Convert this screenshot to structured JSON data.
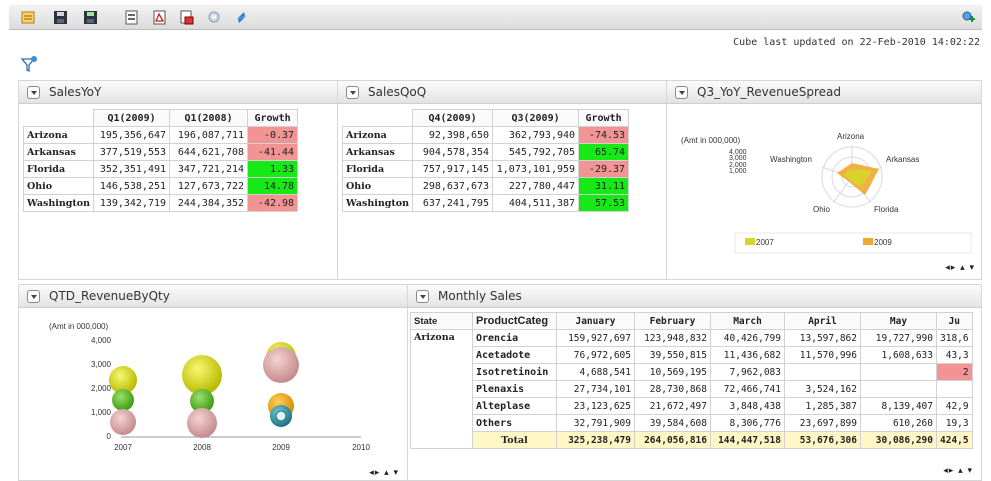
{
  "toolbar": {
    "icons": [
      "edit-icon",
      "save-icon",
      "save-as-icon",
      "export-icon",
      "export-pdf-icon",
      "print-icon",
      "settings-icon",
      "refresh-icon"
    ],
    "right_icon": "add-connection-icon"
  },
  "cube_note": "Cube last updated on 22-Feb-2010 14:02:22",
  "sales_yoy": {
    "title": "SalesYoY",
    "headers": [
      "Q1(2009)",
      "Q1(2008)",
      "Growth"
    ],
    "rows": [
      {
        "state": "Arizona",
        "a": "195,356,647",
        "b": "196,087,711",
        "growth": "-0.37",
        "status": "neg"
      },
      {
        "state": "Arkansas",
        "a": "377,519,553",
        "b": "644,621,708",
        "growth": "-41.44",
        "status": "neg"
      },
      {
        "state": "Florida",
        "a": "352,351,491",
        "b": "347,721,214",
        "growth": "1.33",
        "status": "pos"
      },
      {
        "state": "Ohio",
        "a": "146,538,251",
        "b": "127,673,722",
        "growth": "14.78",
        "status": "pos"
      },
      {
        "state": "Washington",
        "a": "139,342,719",
        "b": "244,384,352",
        "growth": "-42.98",
        "status": "neg"
      }
    ]
  },
  "sales_qoq": {
    "title": "SalesQoQ",
    "headers": [
      "Q4(2009)",
      "Q3(2009)",
      "Growth"
    ],
    "rows": [
      {
        "state": "Arizona",
        "a": "92,398,650",
        "b": "362,793,940",
        "growth": "-74.53",
        "status": "neg"
      },
      {
        "state": "Arkansas",
        "a": "904,578,354",
        "b": "545,792,705",
        "growth": "65.74",
        "status": "pos"
      },
      {
        "state": "Florida",
        "a": "757,917,145",
        "b": "1,073,101,959",
        "growth": "-29.37",
        "status": "neg"
      },
      {
        "state": "Ohio",
        "a": "298,637,673",
        "b": "227,780,447",
        "growth": "31.11",
        "status": "pos"
      },
      {
        "state": "Washington",
        "a": "637,241,795",
        "b": "404,511,387",
        "growth": "57.53",
        "status": "pos"
      }
    ]
  },
  "revenue_spread": {
    "title": "Q3_YoY_RevenueSpread",
    "unit_label": "(Amt  in 000,000)",
    "ticks": [
      "4,000",
      "3,000",
      "2,000",
      "1,000"
    ],
    "axes": [
      "Arizona",
      "Arkansas",
      "Florida",
      "Ohio",
      "Washington"
    ],
    "legend": [
      {
        "name": "2007",
        "color": "#d6d62a"
      },
      {
        "name": "2009",
        "color": "#f0a830"
      }
    ]
  },
  "qtd_revenue": {
    "title": "QTD_RevenueByQty",
    "unit_label": "(Amt  in 000,000)",
    "y_ticks": [
      "4,000",
      "3,000",
      "2,000",
      "1,000",
      "0"
    ],
    "x_ticks": [
      "2007",
      "2008",
      "2009",
      "2010"
    ]
  },
  "monthly_sales": {
    "title": "Monthly Sales",
    "state_header": "State",
    "category_header": "ProductCateg",
    "months": [
      "January",
      "February",
      "March",
      "April",
      "May",
      "Ju"
    ],
    "state": "Arizona",
    "rows": [
      {
        "cat": "Orencia",
        "vals": [
          "159,927,697",
          "123,948,832",
          "40,426,799",
          "13,597,862",
          "19,727,990",
          "318,6"
        ]
      },
      {
        "cat": "Acetadote",
        "vals": [
          "76,972,605",
          "39,550,815",
          "11,436,682",
          "11,570,996",
          "1,608,633",
          "43,3"
        ]
      },
      {
        "cat": "Isotretinoin",
        "vals": [
          "4,688,541",
          "10,569,195",
          "7,962,083",
          "",
          "",
          "2"
        ]
      },
      {
        "cat": "Plenaxis",
        "vals": [
          "27,734,101",
          "28,730,868",
          "72,466,741",
          "3,524,162",
          "",
          ""
        ]
      },
      {
        "cat": "Alteplase",
        "vals": [
          "23,123,625",
          "21,672,497",
          "3,848,438",
          "1,285,387",
          "8,139,407",
          "42,9"
        ]
      },
      {
        "cat": "Others",
        "vals": [
          "32,791,909",
          "39,584,608",
          "8,306,776",
          "23,697,899",
          "610,260",
          "19,3"
        ]
      },
      {
        "cat": "Total",
        "vals": [
          "325,238,479",
          "264,056,816",
          "144,447,518",
          "53,676,306",
          "30,086,290",
          "424,5"
        ]
      }
    ]
  },
  "colors": {
    "negative": "#f39494",
    "positive": "#17e917",
    "total_row": "#fff6c6"
  }
}
